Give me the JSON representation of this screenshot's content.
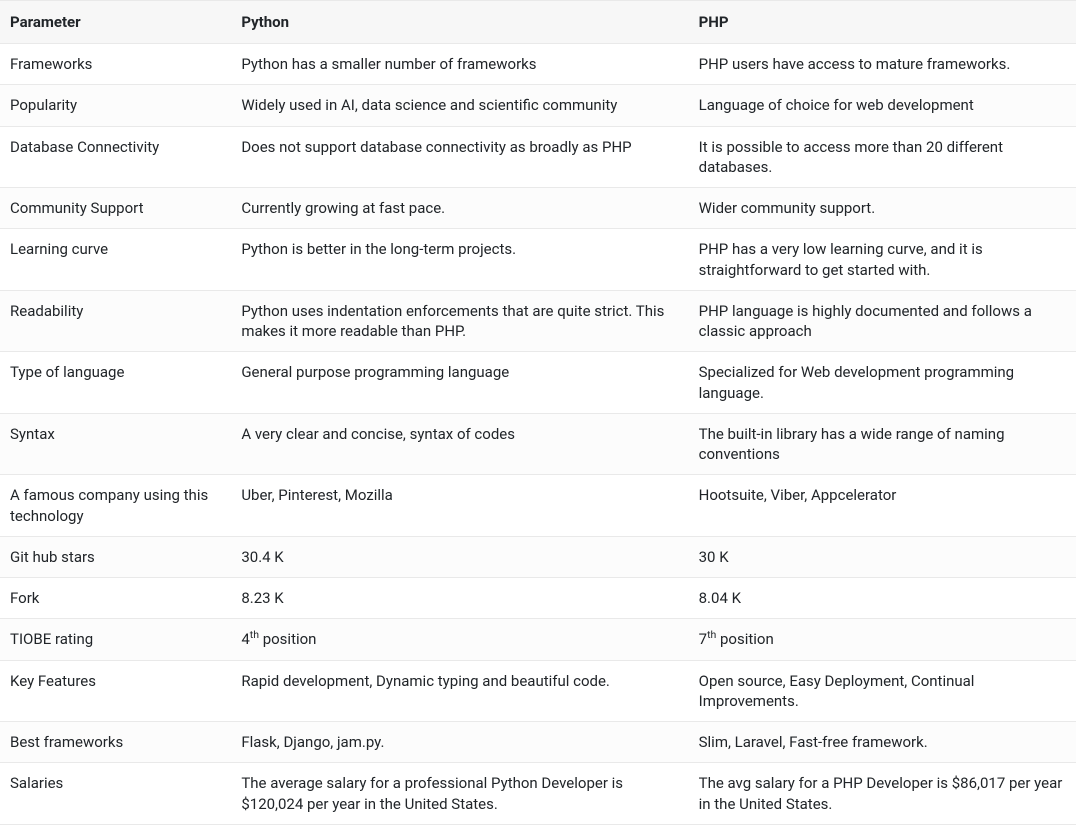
{
  "headers": {
    "parameter": "Parameter",
    "python": "Python",
    "php": "PHP"
  },
  "rows": [
    {
      "parameter": "Frameworks",
      "python": "Python has a smaller number of frameworks",
      "php": "PHP users have access to mature frameworks."
    },
    {
      "parameter": "Popularity",
      "python": "Widely used in AI, data science and scientific community",
      "php": "Language of choice for web development"
    },
    {
      "parameter": "Database Connectivity",
      "python": "Does not support database connectivity as broadly as PHP",
      "php": "It is possible to access more than 20 different databases."
    },
    {
      "parameter": "Community Support",
      "python": "Currently growing at fast pace.",
      "php": "Wider community support."
    },
    {
      "parameter": "Learning curve",
      "python": "Python is better in the long-term projects.",
      "php": "PHP has a very low learning curve, and it is straightforward to get started with."
    },
    {
      "parameter": "Readability",
      "python": "Python uses indentation enforcements that are quite strict. This makes it more readable than PHP.",
      "php": "PHP language is highly documented and follows a classic approach"
    },
    {
      "parameter": "Type of language",
      "python": "General purpose programming language",
      "php": "Specialized for Web development programming language."
    },
    {
      "parameter": "Syntax",
      "python": "A very clear and concise, syntax of codes",
      "php": "The built-in library has a wide range of naming conventions"
    },
    {
      "parameter": "A famous company using this technology",
      "python": "Uber, Pinterest, Mozilla",
      "php": "Hootsuite, Viber, Appcelerator"
    },
    {
      "parameter": "Git hub stars",
      "python": "30.4 K",
      "php": "30 K"
    },
    {
      "parameter": "Fork",
      "python": "8.23 K",
      "php": "8.04 K"
    },
    {
      "parameter": "TIOBE rating",
      "python_html": "4<sup>th</sup> position",
      "php_html": "7<sup>th</sup> position"
    },
    {
      "parameter": "Key Features",
      "python": "Rapid development, Dynamic typing and beautiful code.",
      "php": "Open source, Easy Deployment, Continual Improvements."
    },
    {
      "parameter": "Best frameworks",
      "python": "Flask, Django, jam.py.",
      "php": "Slim, Laravel, Fast-free framework."
    },
    {
      "parameter": "Salaries",
      "python": "The average salary for a professional Python Developer is $120,024 per year in the United States.",
      "php": "The avg salary for a PHP Developer is $86,017 per year in the United States."
    }
  ]
}
